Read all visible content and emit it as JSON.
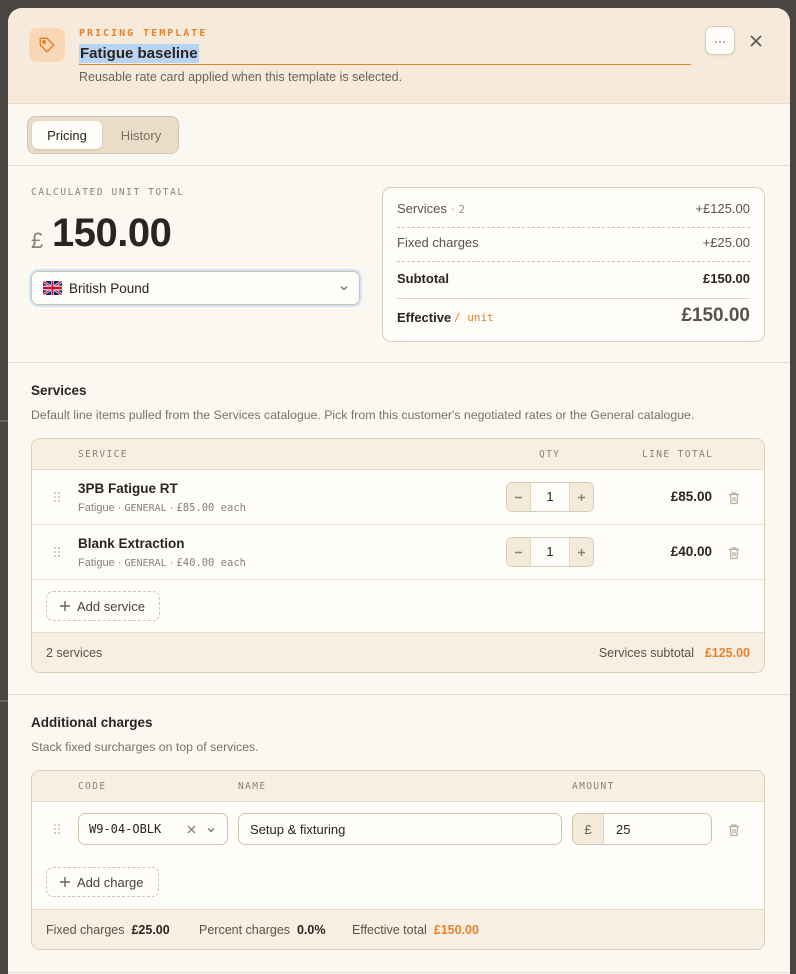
{
  "header": {
    "eyebrow": "PRICING TEMPLATE",
    "title": "Fatigue baseline",
    "subtitle": "Reusable rate card applied when this template is selected.",
    "more_label": "···"
  },
  "tabs": [
    {
      "label": "Pricing",
      "active": true
    },
    {
      "label": "History",
      "active": false
    }
  ],
  "totals": {
    "label": "CALCULATED UNIT TOTAL",
    "symbol": "£",
    "amount": "150.00"
  },
  "currency": {
    "selected": "British Pound",
    "flag": "uk-flag-icon"
  },
  "summary": {
    "services_label": "Services",
    "services_dot": "·",
    "services_count": "2",
    "services_value": "+£125.00",
    "fixed_label": "Fixed charges",
    "fixed_value": "+£25.00",
    "subtotal_label": "Subtotal",
    "subtotal_value": "£150.00",
    "effective_label": "Effective",
    "effective_unit": "/ unit",
    "effective_value": "£150.00"
  },
  "services": {
    "title": "Services",
    "description": "Default line items pulled from the Services catalogue. Pick from this customer's negotiated rates or the General catalogue.",
    "columns": {
      "service": "SERVICE",
      "qty": "QTY",
      "line_total": "LINE TOTAL"
    },
    "rows": [
      {
        "name": "3PB Fatigue RT",
        "category": "Fatigue",
        "catalogue": "GENERAL",
        "price": "£85.00 each",
        "qty": "1",
        "total": "£85.00"
      },
      {
        "name": "Blank Extraction",
        "category": "Fatigue",
        "catalogue": "GENERAL",
        "price": "£40.00 each",
        "qty": "1",
        "total": "£40.00"
      }
    ],
    "add_label": "Add service",
    "footer_count": "2 services",
    "footer_subtotal_label": "Services subtotal",
    "footer_subtotal_value": "£125.00"
  },
  "charges": {
    "title": "Additional charges",
    "description": "Stack fixed surcharges on top of services.",
    "columns": {
      "code": "CODE",
      "name": "NAME",
      "amount": "AMOUNT"
    },
    "rows": [
      {
        "code": "W9-04-OBLK",
        "name": "Setup & fixturing",
        "currency": "£",
        "amount": "25"
      }
    ],
    "add_label": "Add charge",
    "footer": {
      "fixed_label": "Fixed charges",
      "fixed_value": "£25.00",
      "percent_label": "Percent charges",
      "percent_value": "0.0%",
      "effective_label": "Effective total",
      "effective_value": "£150.00"
    }
  },
  "colors": {
    "accent": "#e8812e",
    "header_bg": "#f6ebdb",
    "modal_bg": "#fbf8f2"
  }
}
